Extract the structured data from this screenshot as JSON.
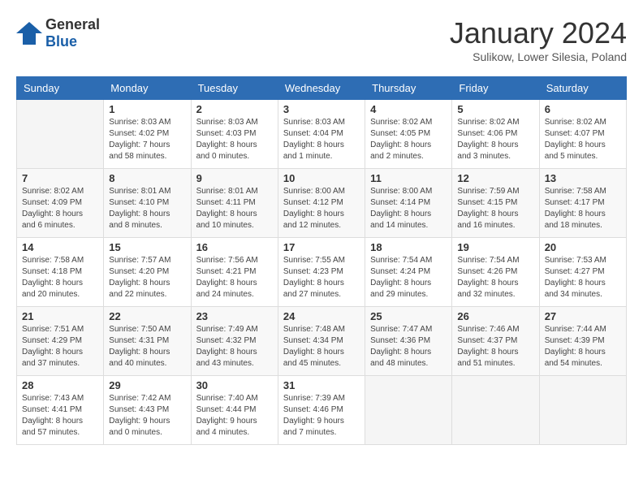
{
  "header": {
    "logo_general": "General",
    "logo_blue": "Blue",
    "month_title": "January 2024",
    "subtitle": "Sulikow, Lower Silesia, Poland"
  },
  "weekdays": [
    "Sunday",
    "Monday",
    "Tuesday",
    "Wednesday",
    "Thursday",
    "Friday",
    "Saturday"
  ],
  "weeks": [
    [
      {
        "day": "",
        "sunrise": "",
        "sunset": "",
        "daylight": ""
      },
      {
        "day": "1",
        "sunrise": "Sunrise: 8:03 AM",
        "sunset": "Sunset: 4:02 PM",
        "daylight": "Daylight: 7 hours and 58 minutes."
      },
      {
        "day": "2",
        "sunrise": "Sunrise: 8:03 AM",
        "sunset": "Sunset: 4:03 PM",
        "daylight": "Daylight: 8 hours and 0 minutes."
      },
      {
        "day": "3",
        "sunrise": "Sunrise: 8:03 AM",
        "sunset": "Sunset: 4:04 PM",
        "daylight": "Daylight: 8 hours and 1 minute."
      },
      {
        "day": "4",
        "sunrise": "Sunrise: 8:02 AM",
        "sunset": "Sunset: 4:05 PM",
        "daylight": "Daylight: 8 hours and 2 minutes."
      },
      {
        "day": "5",
        "sunrise": "Sunrise: 8:02 AM",
        "sunset": "Sunset: 4:06 PM",
        "daylight": "Daylight: 8 hours and 3 minutes."
      },
      {
        "day": "6",
        "sunrise": "Sunrise: 8:02 AM",
        "sunset": "Sunset: 4:07 PM",
        "daylight": "Daylight: 8 hours and 5 minutes."
      }
    ],
    [
      {
        "day": "7",
        "sunrise": "Sunrise: 8:02 AM",
        "sunset": "Sunset: 4:09 PM",
        "daylight": "Daylight: 8 hours and 6 minutes."
      },
      {
        "day": "8",
        "sunrise": "Sunrise: 8:01 AM",
        "sunset": "Sunset: 4:10 PM",
        "daylight": "Daylight: 8 hours and 8 minutes."
      },
      {
        "day": "9",
        "sunrise": "Sunrise: 8:01 AM",
        "sunset": "Sunset: 4:11 PM",
        "daylight": "Daylight: 8 hours and 10 minutes."
      },
      {
        "day": "10",
        "sunrise": "Sunrise: 8:00 AM",
        "sunset": "Sunset: 4:12 PM",
        "daylight": "Daylight: 8 hours and 12 minutes."
      },
      {
        "day": "11",
        "sunrise": "Sunrise: 8:00 AM",
        "sunset": "Sunset: 4:14 PM",
        "daylight": "Daylight: 8 hours and 14 minutes."
      },
      {
        "day": "12",
        "sunrise": "Sunrise: 7:59 AM",
        "sunset": "Sunset: 4:15 PM",
        "daylight": "Daylight: 8 hours and 16 minutes."
      },
      {
        "day": "13",
        "sunrise": "Sunrise: 7:58 AM",
        "sunset": "Sunset: 4:17 PM",
        "daylight": "Daylight: 8 hours and 18 minutes."
      }
    ],
    [
      {
        "day": "14",
        "sunrise": "Sunrise: 7:58 AM",
        "sunset": "Sunset: 4:18 PM",
        "daylight": "Daylight: 8 hours and 20 minutes."
      },
      {
        "day": "15",
        "sunrise": "Sunrise: 7:57 AM",
        "sunset": "Sunset: 4:20 PM",
        "daylight": "Daylight: 8 hours and 22 minutes."
      },
      {
        "day": "16",
        "sunrise": "Sunrise: 7:56 AM",
        "sunset": "Sunset: 4:21 PM",
        "daylight": "Daylight: 8 hours and 24 minutes."
      },
      {
        "day": "17",
        "sunrise": "Sunrise: 7:55 AM",
        "sunset": "Sunset: 4:23 PM",
        "daylight": "Daylight: 8 hours and 27 minutes."
      },
      {
        "day": "18",
        "sunrise": "Sunrise: 7:54 AM",
        "sunset": "Sunset: 4:24 PM",
        "daylight": "Daylight: 8 hours and 29 minutes."
      },
      {
        "day": "19",
        "sunrise": "Sunrise: 7:54 AM",
        "sunset": "Sunset: 4:26 PM",
        "daylight": "Daylight: 8 hours and 32 minutes."
      },
      {
        "day": "20",
        "sunrise": "Sunrise: 7:53 AM",
        "sunset": "Sunset: 4:27 PM",
        "daylight": "Daylight: 8 hours and 34 minutes."
      }
    ],
    [
      {
        "day": "21",
        "sunrise": "Sunrise: 7:51 AM",
        "sunset": "Sunset: 4:29 PM",
        "daylight": "Daylight: 8 hours and 37 minutes."
      },
      {
        "day": "22",
        "sunrise": "Sunrise: 7:50 AM",
        "sunset": "Sunset: 4:31 PM",
        "daylight": "Daylight: 8 hours and 40 minutes."
      },
      {
        "day": "23",
        "sunrise": "Sunrise: 7:49 AM",
        "sunset": "Sunset: 4:32 PM",
        "daylight": "Daylight: 8 hours and 43 minutes."
      },
      {
        "day": "24",
        "sunrise": "Sunrise: 7:48 AM",
        "sunset": "Sunset: 4:34 PM",
        "daylight": "Daylight: 8 hours and 45 minutes."
      },
      {
        "day": "25",
        "sunrise": "Sunrise: 7:47 AM",
        "sunset": "Sunset: 4:36 PM",
        "daylight": "Daylight: 8 hours and 48 minutes."
      },
      {
        "day": "26",
        "sunrise": "Sunrise: 7:46 AM",
        "sunset": "Sunset: 4:37 PM",
        "daylight": "Daylight: 8 hours and 51 minutes."
      },
      {
        "day": "27",
        "sunrise": "Sunrise: 7:44 AM",
        "sunset": "Sunset: 4:39 PM",
        "daylight": "Daylight: 8 hours and 54 minutes."
      }
    ],
    [
      {
        "day": "28",
        "sunrise": "Sunrise: 7:43 AM",
        "sunset": "Sunset: 4:41 PM",
        "daylight": "Daylight: 8 hours and 57 minutes."
      },
      {
        "day": "29",
        "sunrise": "Sunrise: 7:42 AM",
        "sunset": "Sunset: 4:43 PM",
        "daylight": "Daylight: 9 hours and 0 minutes."
      },
      {
        "day": "30",
        "sunrise": "Sunrise: 7:40 AM",
        "sunset": "Sunset: 4:44 PM",
        "daylight": "Daylight: 9 hours and 4 minutes."
      },
      {
        "day": "31",
        "sunrise": "Sunrise: 7:39 AM",
        "sunset": "Sunset: 4:46 PM",
        "daylight": "Daylight: 9 hours and 7 minutes."
      },
      {
        "day": "",
        "sunrise": "",
        "sunset": "",
        "daylight": ""
      },
      {
        "day": "",
        "sunrise": "",
        "sunset": "",
        "daylight": ""
      },
      {
        "day": "",
        "sunrise": "",
        "sunset": "",
        "daylight": ""
      }
    ]
  ]
}
